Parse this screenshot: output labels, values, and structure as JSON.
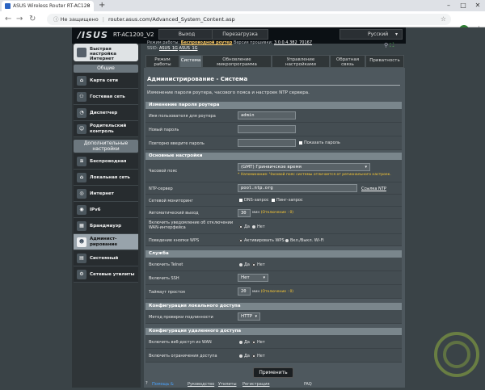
{
  "browser": {
    "tab_title": "ASUS Wireless Router RT-AC120",
    "new_tab": "+",
    "insecure_label": "Не защищено",
    "url": "router.asus.com/Advanced_System_Content.asp",
    "profile_letter": "G"
  },
  "header": {
    "logo": "/ISUS",
    "model": "RT-AC1200_V2",
    "logout": "Выход",
    "reboot": "Перезагрузка",
    "language": "Русский",
    "mode_label": "Режим работы:",
    "mode_value": "Беспроводной роутер",
    "fw_label": "Версия прошивки:",
    "fw_value": "3.0.0.4.382_70167",
    "ssid_label": "SSID:",
    "ssid1": "ASUS_1G",
    "ssid2": "ASUS_1G"
  },
  "sidebar": {
    "qis": "Быстрая настройка Интернет",
    "general": "Общие",
    "advanced": "Дополнительные настройки",
    "items": [
      {
        "label": "Карта сети"
      },
      {
        "label": "Гостевая сеть"
      },
      {
        "label": "Диспетчер трафика"
      },
      {
        "label": "Родительский контроль"
      },
      {
        "label": "Беспроводная сеть"
      },
      {
        "label": "Локальная сеть"
      },
      {
        "label": "Интернет"
      },
      {
        "label": "IPv6"
      },
      {
        "label": "Брандмауэр"
      },
      {
        "label": "Админист­рирование"
      },
      {
        "label": "Системный журнал"
      },
      {
        "label": "Сетевые утилиты"
      }
    ]
  },
  "tabs": [
    {
      "label": "Режим работы"
    },
    {
      "label": "Система"
    },
    {
      "label": "Обновление микропрограмма"
    },
    {
      "label": "Управление настройками"
    },
    {
      "label": "Обратная связь"
    },
    {
      "label": "Приватность"
    }
  ],
  "content": {
    "title": "Администрирование - Система",
    "description": "Изменение пароля роутера, часового пояса и настроек NTP сервера.",
    "sections": {
      "password": "Изменение пароля роутера",
      "basic": "Основные настройки",
      "service": "Служба",
      "local": "Конфигурация локального доступа",
      "remote": "Конфигурация удаленного доступа"
    },
    "fields": {
      "username_label": "Имя пользователя для роутера",
      "username_value": "admin",
      "newpass_label": "Новый пароль",
      "repass_label": "Повторно введите пароль",
      "showpass_label": "Показать пароль",
      "tz_label": "Часовой пояс",
      "tz_value": "(GMT) Гринвичское время",
      "tz_hint": "* Напоминание: Часовой пояс системы отличается от регионального настроек.",
      "ntp_label": "NTP-сервер",
      "ntp_value": "pool.ntp.org",
      "ntp_link": "Ссылка NTP",
      "netmon_label": "Сетевой мониторинг",
      "dns_query": "DNS-запрос",
      "ping_query": "Пинг-запрос",
      "autologout_label": "Автоматический выход",
      "autologout_value": "30",
      "autologout_unit": "мин",
      "autologout_default": "(Отключение : 0)",
      "wan_notify_label": "Включить уведомление об отключении WAN-интерфейса",
      "yes": "Да",
      "no": "Нет",
      "wps_label": "Поведение кнопки WPS",
      "wps_opt1": "Активировать WPS",
      "wps_opt2": "Вкл./Выкл. Wi-Fi",
      "telnet_label": "Включить Telnet",
      "ssh_label": "Включить SSH",
      "ssh_value": "Нет",
      "idle_label": "Таймаут простоя",
      "idle_value": "20",
      "idle_unit": "мин",
      "idle_default": "(Отключение : 0)",
      "auth_label": "Метод проверки подлинности",
      "auth_value": "HTTP",
      "webwan_label": "Включить веб-доступ из WAN",
      "restrict_label": "Включить ограничения доступа"
    },
    "apply": "Применить"
  },
  "footer": {
    "help": "Помощь &",
    "manual": "Руководство",
    "utils": "Утилиты",
    "register": "Регистрация",
    "faq": "FAQ"
  }
}
